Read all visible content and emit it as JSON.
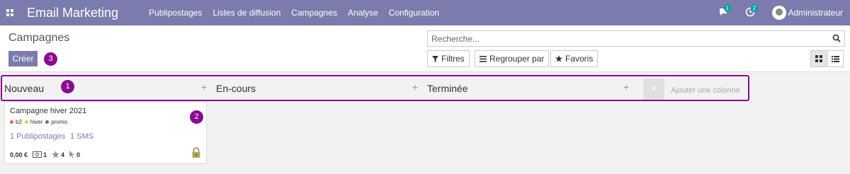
{
  "navbar": {
    "app_title": "Email Marketing",
    "menu": [
      "Publipostages",
      "Listes de diffusion",
      "Campagnes",
      "Analyse",
      "Configuration"
    ],
    "messages_count": "1",
    "activities_count": "2",
    "user_name": "Administrateur",
    "bg_color": "#7c7bad"
  },
  "control_panel": {
    "title": "Campagnes",
    "create_label": "Créer",
    "search_placeholder": "Recherche...",
    "filters_label": "Filtres",
    "group_by_label": "Regrouper par",
    "favorites_label": "Favoris"
  },
  "markers": [
    "1",
    "2",
    "3"
  ],
  "kanban": {
    "columns": [
      {
        "title": "Nouveau"
      },
      {
        "title": "En-cours"
      },
      {
        "title": "Terminée"
      }
    ],
    "add_column_icon": "+",
    "add_column_label": "Ajouter une colonne",
    "card": {
      "title": "Campagne hiver 2021",
      "tags": [
        {
          "label": "b2",
          "color": "#f06050"
        },
        {
          "label": "hiver",
          "color": "#f4c430"
        },
        {
          "label": "promo",
          "color": "#4a7aa8"
        }
      ],
      "mailings": "1 Publipostages",
      "sms": "1 SMS",
      "amount": "0,00 €",
      "clicks": "1",
      "rating": "4",
      "opens": "0"
    }
  },
  "icons": [
    "apps-icon",
    "chat-icon",
    "clock-icon",
    "avatar",
    "search-icon",
    "filter-icon",
    "list-icon",
    "star-icon",
    "kanban-icon",
    "plus-icon",
    "money-icon",
    "cursor-icon",
    "lock-icon"
  ]
}
